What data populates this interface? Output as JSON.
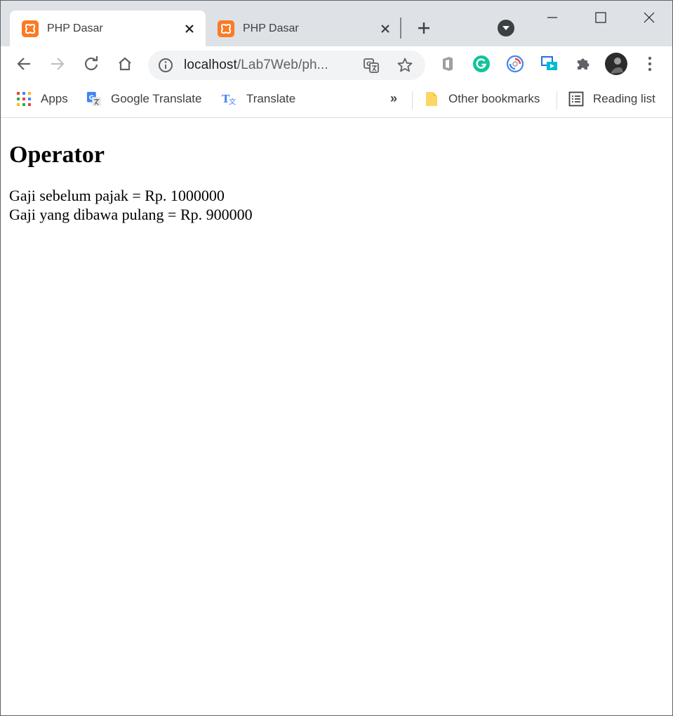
{
  "tabs": [
    {
      "title": "PHP Dasar",
      "active": true
    },
    {
      "title": "PHP Dasar",
      "active": false
    }
  ],
  "toolbar": {
    "url_host": "localhost",
    "url_path": "/Lab7Web/ph..."
  },
  "bookmarks": {
    "items": [
      {
        "label": "Apps",
        "icon": "apps-grid-icon"
      },
      {
        "label": "Google Translate",
        "icon": "google-translate-icon"
      },
      {
        "label": "Translate",
        "icon": "translate-icon"
      }
    ],
    "overflow": "»",
    "other": "Other bookmarks",
    "reading_list": "Reading list"
  },
  "page": {
    "heading": "Operator",
    "lines": [
      "Gaji sebelum pajak = Rp. 1000000",
      "Gaji yang dibawa pulang = Rp. 900000"
    ]
  },
  "colors": {
    "tabstrip": "#dee1e6",
    "xampp_orange": "#fb7a24",
    "omnibox": "#f1f3f4",
    "icon_gray": "#5f6368"
  }
}
